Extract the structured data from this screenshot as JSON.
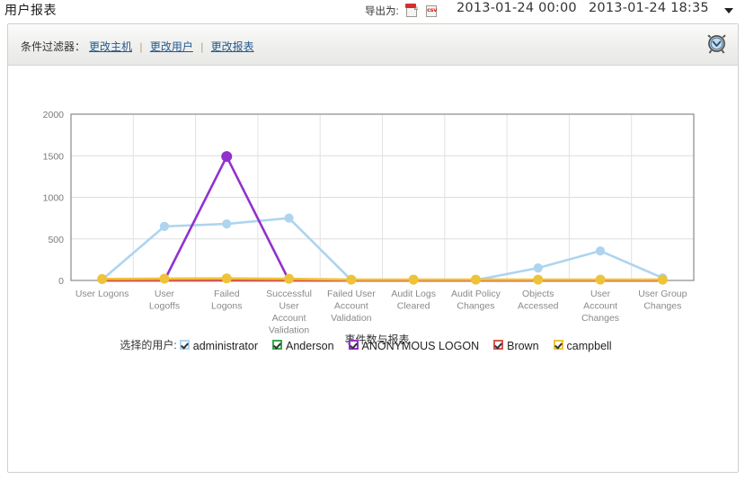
{
  "header": {
    "title": "用户报表",
    "export_label": "导出为:",
    "pdf_icon": "pdf-export-icon",
    "csv_icon": "csv-export-icon",
    "date_from": "2013-01-24 00:00",
    "date_to": "2013-01-24 18:35",
    "dropdown_icon": "caret-down-icon"
  },
  "filter": {
    "label": "条件过滤器：",
    "links": [
      {
        "label": "更改主机"
      },
      {
        "label": "更改用户"
      },
      {
        "label": "更改报表"
      }
    ],
    "separator": "|",
    "schedule_icon": "clock-icon"
  },
  "legend": {
    "title": "选择的用户:",
    "items": [
      {
        "label": "administrator",
        "color": "#aed4ef",
        "checked": true
      },
      {
        "label": "Anderson",
        "color": "#3aa64c",
        "checked": true
      },
      {
        "label": "ANONYMOUS LOGON",
        "color": "#9131cf",
        "checked": true
      },
      {
        "label": "Brown",
        "color": "#d9534f",
        "checked": true
      },
      {
        "label": "campbell",
        "color": "#eec33a",
        "checked": true
      }
    ]
  },
  "chart_data": {
    "type": "line",
    "title": "",
    "xlabel": "事件数与报表",
    "ylabel": "",
    "ylim": [
      0,
      2000
    ],
    "yticks": [
      0,
      500,
      1000,
      1500,
      2000
    ],
    "grid": true,
    "legend_position": "bottom",
    "categories": [
      "User Logons",
      "User Logoffs",
      "Failed Logons",
      "Successful User Account Validation",
      "Failed User Account Validation",
      "Audit Logs Cleared",
      "Audit Policy Changes",
      "Objects Accessed",
      "User Account Changes",
      "User Group Changes"
    ],
    "series": [
      {
        "name": "administrator",
        "color": "#aed4ef",
        "values": [
          10,
          650,
          680,
          750,
          5,
          5,
          5,
          150,
          355,
          30
        ]
      },
      {
        "name": "Anderson",
        "color": "#3aa64c",
        "values": [
          0,
          0,
          0,
          0,
          0,
          0,
          0,
          0,
          0,
          0
        ]
      },
      {
        "name": "ANONYMOUS LOGON",
        "color": "#9131cf",
        "values": [
          0,
          0,
          1490,
          0,
          0,
          0,
          0,
          0,
          0,
          0
        ]
      },
      {
        "name": "Brown",
        "color": "#d9534f",
        "values": [
          0,
          0,
          0,
          0,
          0,
          0,
          0,
          0,
          0,
          0
        ]
      },
      {
        "name": "campbell",
        "color": "#eec33a",
        "values": [
          18,
          22,
          25,
          20,
          10,
          10,
          10,
          10,
          10,
          10
        ]
      }
    ]
  }
}
